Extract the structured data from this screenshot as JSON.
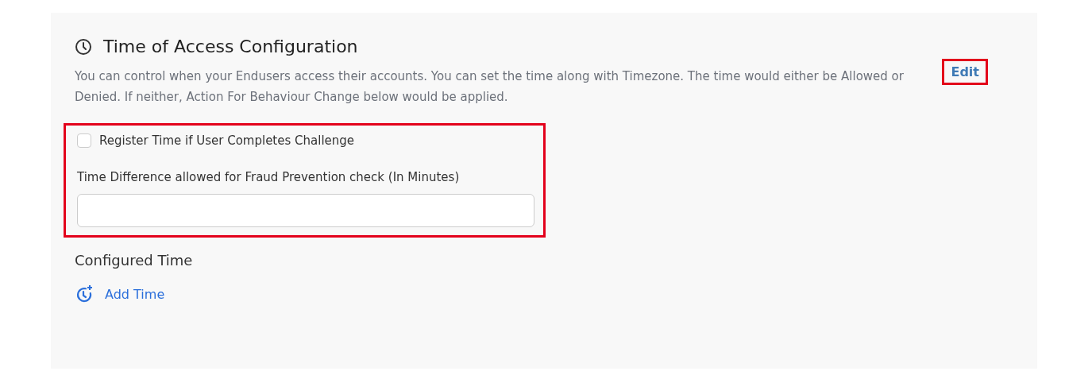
{
  "section": {
    "title": "Time of Access Configuration",
    "description": "You can control when your Endusers access their accounts. You can set the time along with Timezone. The time would either be Allowed or Denied. If neither, Action For Behaviour Change below would be applied.",
    "edit": {
      "label": "Edit",
      "highlighted": true
    }
  },
  "fraud_group": {
    "highlighted": true,
    "checkbox": {
      "label": "Register Time if User Completes Challenge",
      "checked": false
    },
    "field": {
      "label": "Time Difference allowed for Fraud Prevention check (In Minutes)"
    }
  },
  "configured": {
    "title": "Configured Time",
    "add_link": "Add Time"
  }
}
